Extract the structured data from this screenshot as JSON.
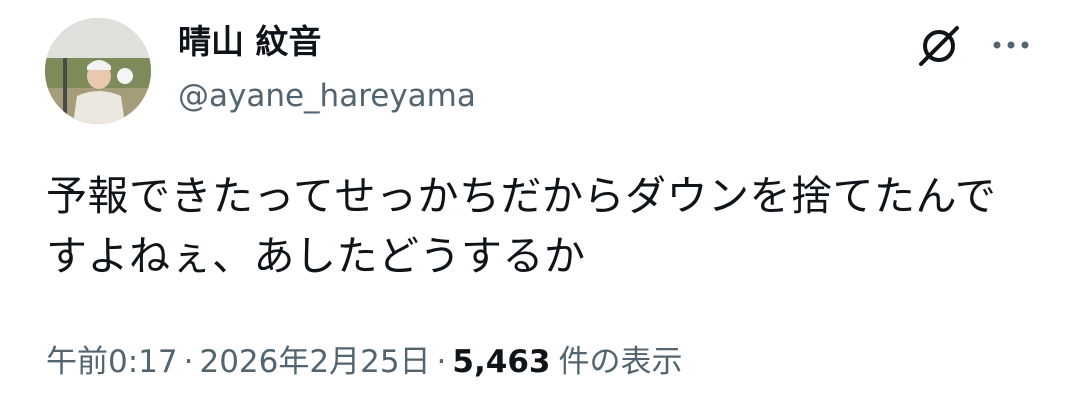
{
  "author": {
    "display_name": "晴山 紋音",
    "handle": "@ayane_hareyama"
  },
  "icons": {
    "grok": "grok-icon",
    "more": "more-icon"
  },
  "tweet": {
    "text_lines": [
      "予報できたってせっかちだからダウンを捨てたんで",
      "すよねぇ、あしたどうするか"
    ]
  },
  "meta": {
    "time": "午前0:17",
    "separator": "·",
    "date": "2026年2月25日",
    "views_count": "5,463",
    "views_label": "件の表示"
  },
  "colors": {
    "text_primary": "#0f1419",
    "text_secondary": "#536471",
    "background": "#ffffff"
  }
}
